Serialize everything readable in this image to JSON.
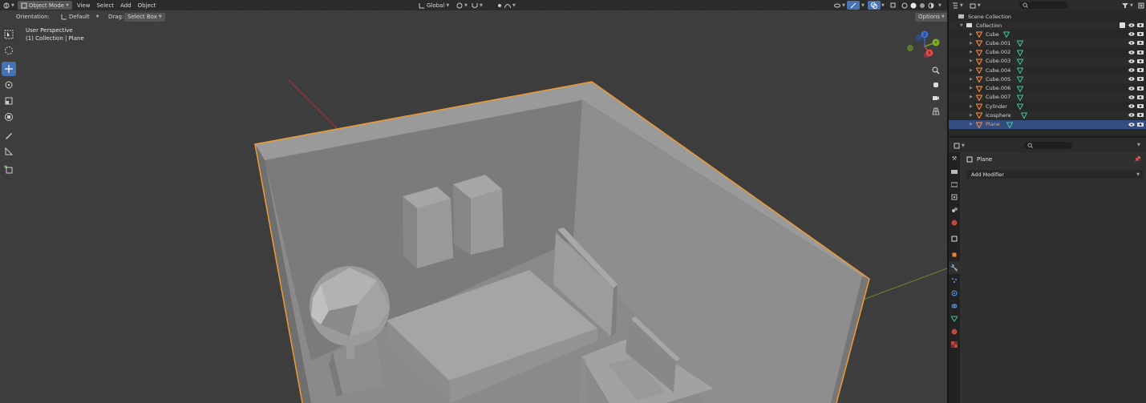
{
  "viewport_header": {
    "editor_icon": "3d-viewport-icon",
    "mode": "Object Mode",
    "menus": [
      "View",
      "Select",
      "Add",
      "Object"
    ],
    "transform_orientation": "Global",
    "options_label": "Options"
  },
  "tool_settings": {
    "orientation_label": "Orientation:",
    "orientation_value": "Default",
    "drag_label": "Drag:",
    "drag_value": "Select Box"
  },
  "viewport_overlay": {
    "line1": "User Perspective",
    "line2": "(1) Collection | Plane"
  },
  "gizmo": {
    "x_label": "X",
    "y_label": "Y",
    "z_label": "Z"
  },
  "outliner": {
    "scene_collection": "Scene Collection",
    "collection": "Collection",
    "objects": [
      "Cube",
      "Cube.001",
      "Cube.002",
      "Cube.003",
      "Cube.004",
      "Cube.005",
      "Cube.006",
      "Cube.007",
      "Cylinder",
      "Icosphere",
      "Plane"
    ],
    "selected": "Plane"
  },
  "properties": {
    "object_name": "Plane",
    "add_modifier": "Add Modifier"
  },
  "colors": {
    "accent": "#4772b3",
    "selection_outline": "#f09a30",
    "mesh_icon": "#e8813a",
    "data_icon": "#3fc6a0"
  }
}
